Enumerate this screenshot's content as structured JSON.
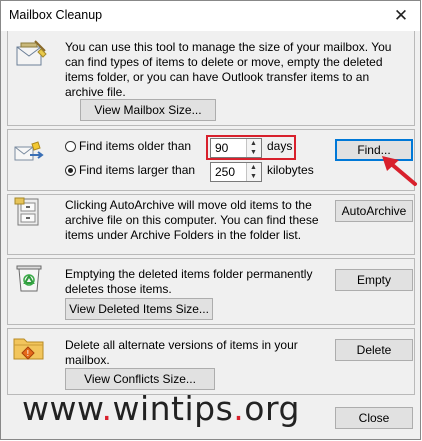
{
  "dialog": {
    "title": "Mailbox Cleanup"
  },
  "mailbox_size": {
    "description": "You can use this tool to manage the size of your mailbox. You can find types of items to delete or move, empty the deleted items folder, or you can have Outlook transfer items to an archive file.",
    "button": "View Mailbox Size..."
  },
  "find": {
    "older_label": "Find items older than",
    "older_value": "90",
    "older_unit": "days",
    "larger_label": "Find items larger than",
    "larger_value": "250",
    "larger_unit": "kilobytes",
    "selected": "larger",
    "button": "Find..."
  },
  "autoarchive": {
    "description": "Clicking AutoArchive will move old items to the archive file on this computer. You can find these items under Archive Folders in the folder list.",
    "button": "AutoArchive"
  },
  "deleted_items": {
    "description": "Emptying the deleted items folder permanently deletes those items.",
    "view_button": "View Deleted Items Size...",
    "empty_button": "Empty"
  },
  "conflicts": {
    "description": "Delete all alternate versions of items in your mailbox.",
    "view_button": "View Conflicts Size...",
    "delete_button": "Delete"
  },
  "footer": {
    "close_button": "Close"
  },
  "watermark": {
    "prefix": "www",
    "name": "wintips",
    "suffix": "org"
  },
  "colors": {
    "highlight": "#d8202c",
    "focus": "#0078d7"
  },
  "icons": [
    "mailbox-broom-icon",
    "find-items-icon",
    "archive-cabinet-icon",
    "recycle-bin-icon",
    "conflict-folder-icon",
    "spin-up-icon",
    "spin-down-icon",
    "close-icon",
    "red-arrow-icon"
  ]
}
